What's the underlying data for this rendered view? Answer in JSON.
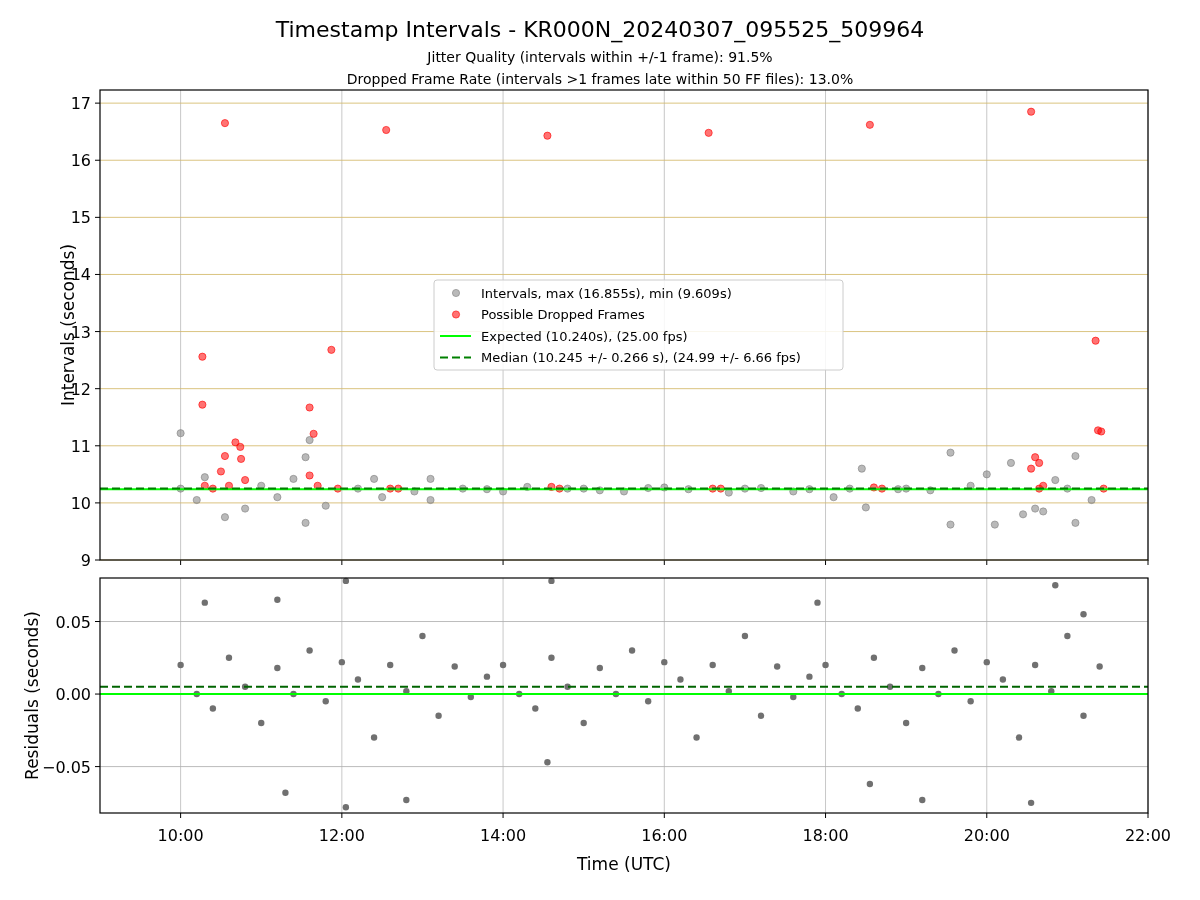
{
  "title": "Timestamp Intervals - KR000N_20240307_095525_509964",
  "subtitles": [
    "Jitter Quality (intervals within +/-1 frame): 91.5%",
    "Dropped Frame Rate (intervals >1 frames late within 50 FF files): 13.0%"
  ],
  "plots": [
    {
      "chart_data": {
        "type": "scatter",
        "grid": true,
        "legend": "center",
        "ylabel": "Intervals (seconds)",
        "xlim": [
          9.0,
          22.0
        ],
        "ylim": [
          9.0,
          17.23
        ],
        "yticks": [
          {
            "value": 9,
            "label": "9"
          },
          {
            "value": 10,
            "label": "10"
          },
          {
            "value": 11,
            "label": "11"
          },
          {
            "value": 12,
            "label": "12"
          },
          {
            "value": 13,
            "label": "13"
          },
          {
            "value": 14,
            "label": "14"
          },
          {
            "value": 15,
            "label": "15"
          },
          {
            "value": 16,
            "label": "16"
          },
          {
            "value": 17,
            "label": "17"
          }
        ],
        "series": [
          {
            "name": "Intervals, max (16.855s), min (9.609s)",
            "type": "scatter",
            "color": "#808080",
            "x": [
              10.0,
              10.0,
              10.2,
              10.3,
              10.55,
              10.8,
              11.0,
              11.2,
              11.4,
              11.55,
              11.6,
              11.55,
              11.8,
              12.2,
              12.4,
              12.5,
              12.9,
              13.1,
              13.1,
              13.5,
              13.8,
              14.0,
              14.3,
              14.8,
              15.0,
              15.2,
              15.5,
              15.8,
              16.0,
              16.3,
              16.8,
              17.0,
              17.2,
              17.6,
              17.8,
              18.1,
              18.3,
              18.45,
              18.5,
              18.9,
              19.0,
              19.3,
              19.55,
              19.55,
              19.8,
              20.0,
              20.1,
              20.3,
              20.45,
              20.6,
              20.7,
              20.85,
              21.0,
              21.1,
              21.1,
              21.3
            ],
            "values": [
              11.22,
              10.25,
              10.05,
              10.45,
              9.75,
              9.9,
              10.3,
              10.1,
              10.42,
              9.65,
              11.1,
              10.8,
              9.95,
              10.25,
              10.42,
              10.1,
              10.2,
              10.42,
              10.05,
              10.25,
              10.24,
              10.2,
              10.28,
              10.25,
              10.25,
              10.22,
              10.2,
              10.26,
              10.27,
              10.24,
              10.18,
              10.25,
              10.26,
              10.2,
              10.24,
              10.1,
              10.25,
              10.6,
              9.92,
              10.24,
              10.25,
              10.22,
              10.88,
              9.62,
              10.3,
              10.5,
              9.62,
              10.7,
              9.8,
              9.9,
              9.85,
              10.4,
              10.25,
              10.82,
              9.65,
              10.05
            ]
          },
          {
            "name": "Possible Dropped Frames",
            "type": "scatter",
            "color": "#ff0000",
            "x": [
              10.27,
              10.27,
              10.3,
              10.4,
              10.5,
              10.55,
              10.55,
              10.6,
              10.68,
              10.74,
              10.75,
              10.8,
              11.6,
              11.6,
              11.65,
              11.7,
              11.87,
              11.95,
              12.55,
              12.6,
              12.7,
              14.55,
              14.6,
              14.7,
              16.55,
              16.6,
              16.7,
              18.55,
              18.6,
              18.7,
              20.55,
              20.55,
              20.6,
              20.65,
              20.65,
              20.7,
              21.35,
              21.38,
              21.42,
              21.45
            ],
            "values": [
              12.56,
              11.72,
              10.3,
              10.25,
              10.55,
              16.65,
              10.82,
              10.3,
              11.06,
              10.98,
              10.77,
              10.4,
              11.67,
              10.48,
              11.21,
              10.3,
              12.68,
              10.25,
              16.53,
              10.25,
              10.25,
              16.43,
              10.28,
              10.25,
              16.48,
              10.25,
              10.25,
              16.62,
              10.27,
              10.25,
              16.85,
              10.6,
              10.8,
              10.7,
              10.25,
              10.3,
              12.84,
              11.27,
              11.25,
              10.25
            ]
          },
          {
            "name": "Expected (10.240s), (25.00 fps)",
            "type": "line",
            "line_style": "solid",
            "color": "#00ff00",
            "x": [
              9.0,
              22.0
            ],
            "values": [
              10.24,
              10.24
            ]
          },
          {
            "name": "Median (10.245 +/- 0.266 s), (24.99 +/- 6.66 fps)",
            "type": "line",
            "line_style": "dashed",
            "color": "#008000",
            "x": [
              9.0,
              22.0
            ],
            "values": [
              10.25,
              10.25
            ]
          }
        ]
      }
    },
    {
      "chart_data": {
        "type": "scatter",
        "grid": true,
        "xlabel": "Time (UTC)",
        "ylabel": "Residuals (seconds)",
        "xlim": [
          9.0,
          22.0
        ],
        "ylim": [
          -0.082,
          0.08
        ],
        "xticks": [
          {
            "value": 10,
            "label": "10:00"
          },
          {
            "value": 12,
            "label": "12:00"
          },
          {
            "value": 14,
            "label": "14:00"
          },
          {
            "value": 16,
            "label": "16:00"
          },
          {
            "value": 18,
            "label": "18:00"
          },
          {
            "value": 20,
            "label": "20:00"
          },
          {
            "value": 22,
            "label": "22:00"
          }
        ],
        "yticks": [
          {
            "value": -0.05,
            "label": "−0.05"
          },
          {
            "value": 0,
            "label": "0.00"
          },
          {
            "value": 0.05,
            "label": "0.05"
          }
        ],
        "series": [
          {
            "type": "scatter",
            "color": "#707070",
            "x": [
              10.0,
              10.2,
              10.4,
              10.6,
              10.8,
              11.0,
              11.2,
              11.4,
              11.6,
              11.8,
              12.0,
              12.2,
              12.4,
              12.6,
              12.8,
              13.0,
              13.2,
              13.4,
              13.6,
              13.8,
              14.0,
              14.2,
              14.4,
              14.6,
              14.8,
              15.0,
              15.2,
              15.4,
              15.6,
              15.8,
              16.0,
              16.2,
              16.4,
              16.6,
              16.8,
              17.0,
              17.2,
              17.4,
              17.6,
              17.8,
              18.0,
              18.2,
              18.4,
              18.6,
              18.8,
              19.0,
              19.2,
              19.4,
              19.6,
              19.8,
              20.0,
              20.2,
              20.4,
              20.6,
              20.8,
              21.0,
              21.2,
              21.4,
              10.3,
              11.3,
              12.05,
              12.05,
              12.8,
              14.6,
              14.55,
              19.2,
              20.55,
              20.85,
              18.55,
              17.9,
              11.2,
              21.2
            ],
            "values": [
              0.02,
              0.0,
              -0.01,
              0.025,
              0.005,
              -0.02,
              0.018,
              0.0,
              0.03,
              -0.005,
              0.022,
              0.01,
              -0.03,
              0.02,
              0.002,
              0.04,
              -0.015,
              0.019,
              -0.002,
              0.012,
              0.02,
              0.0,
              -0.01,
              0.025,
              0.005,
              -0.02,
              0.018,
              0.0,
              0.03,
              -0.005,
              0.022,
              0.01,
              -0.03,
              0.02,
              0.002,
              0.04,
              -0.015,
              0.019,
              -0.002,
              0.012,
              0.02,
              0.0,
              -0.01,
              0.025,
              0.005,
              -0.02,
              0.018,
              0.0,
              0.03,
              -0.005,
              0.022,
              0.01,
              -0.03,
              0.02,
              0.002,
              0.04,
              -0.015,
              0.019,
              0.063,
              -0.068,
              0.078,
              -0.078,
              -0.073,
              0.078,
              -0.047,
              -0.073,
              -0.075,
              0.075,
              -0.062,
              0.063,
              0.065,
              0.055
            ]
          },
          {
            "type": "line",
            "line_style": "solid",
            "color": "#00ff00",
            "x": [
              9.0,
              22.0
            ],
            "values": [
              0.0,
              0.0
            ]
          },
          {
            "type": "line",
            "line_style": "dashed",
            "color": "#006400",
            "x": [
              9.0,
              22.0
            ],
            "values": [
              0.005,
              0.005
            ]
          }
        ]
      }
    }
  ]
}
